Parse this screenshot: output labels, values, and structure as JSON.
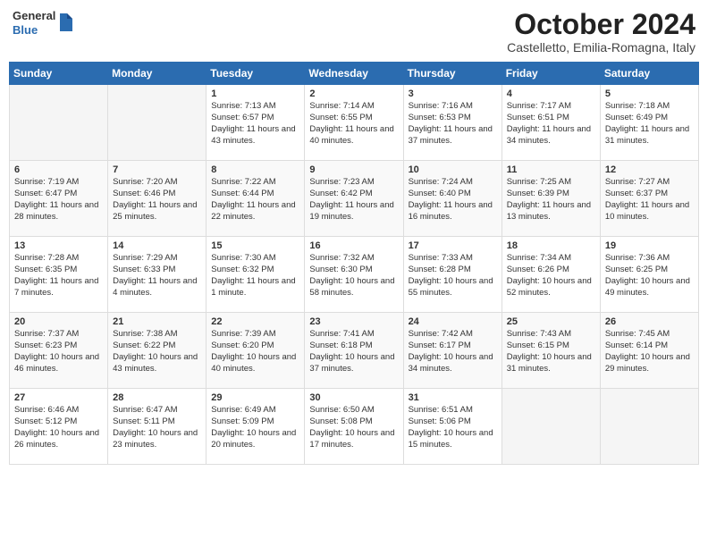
{
  "header": {
    "logo_line1": "General",
    "logo_line2": "Blue",
    "month_title": "October 2024",
    "location": "Castelletto, Emilia-Romagna, Italy"
  },
  "days_of_week": [
    "Sunday",
    "Monday",
    "Tuesday",
    "Wednesday",
    "Thursday",
    "Friday",
    "Saturday"
  ],
  "weeks": [
    [
      {
        "day": "",
        "empty": true
      },
      {
        "day": "",
        "empty": true
      },
      {
        "day": "1",
        "sunrise": "Sunrise: 7:13 AM",
        "sunset": "Sunset: 6:57 PM",
        "daylight": "Daylight: 11 hours and 43 minutes."
      },
      {
        "day": "2",
        "sunrise": "Sunrise: 7:14 AM",
        "sunset": "Sunset: 6:55 PM",
        "daylight": "Daylight: 11 hours and 40 minutes."
      },
      {
        "day": "3",
        "sunrise": "Sunrise: 7:16 AM",
        "sunset": "Sunset: 6:53 PM",
        "daylight": "Daylight: 11 hours and 37 minutes."
      },
      {
        "day": "4",
        "sunrise": "Sunrise: 7:17 AM",
        "sunset": "Sunset: 6:51 PM",
        "daylight": "Daylight: 11 hours and 34 minutes."
      },
      {
        "day": "5",
        "sunrise": "Sunrise: 7:18 AM",
        "sunset": "Sunset: 6:49 PM",
        "daylight": "Daylight: 11 hours and 31 minutes."
      }
    ],
    [
      {
        "day": "6",
        "sunrise": "Sunrise: 7:19 AM",
        "sunset": "Sunset: 6:47 PM",
        "daylight": "Daylight: 11 hours and 28 minutes."
      },
      {
        "day": "7",
        "sunrise": "Sunrise: 7:20 AM",
        "sunset": "Sunset: 6:46 PM",
        "daylight": "Daylight: 11 hours and 25 minutes."
      },
      {
        "day": "8",
        "sunrise": "Sunrise: 7:22 AM",
        "sunset": "Sunset: 6:44 PM",
        "daylight": "Daylight: 11 hours and 22 minutes."
      },
      {
        "day": "9",
        "sunrise": "Sunrise: 7:23 AM",
        "sunset": "Sunset: 6:42 PM",
        "daylight": "Daylight: 11 hours and 19 minutes."
      },
      {
        "day": "10",
        "sunrise": "Sunrise: 7:24 AM",
        "sunset": "Sunset: 6:40 PM",
        "daylight": "Daylight: 11 hours and 16 minutes."
      },
      {
        "day": "11",
        "sunrise": "Sunrise: 7:25 AM",
        "sunset": "Sunset: 6:39 PM",
        "daylight": "Daylight: 11 hours and 13 minutes."
      },
      {
        "day": "12",
        "sunrise": "Sunrise: 7:27 AM",
        "sunset": "Sunset: 6:37 PM",
        "daylight": "Daylight: 11 hours and 10 minutes."
      }
    ],
    [
      {
        "day": "13",
        "sunrise": "Sunrise: 7:28 AM",
        "sunset": "Sunset: 6:35 PM",
        "daylight": "Daylight: 11 hours and 7 minutes."
      },
      {
        "day": "14",
        "sunrise": "Sunrise: 7:29 AM",
        "sunset": "Sunset: 6:33 PM",
        "daylight": "Daylight: 11 hours and 4 minutes."
      },
      {
        "day": "15",
        "sunrise": "Sunrise: 7:30 AM",
        "sunset": "Sunset: 6:32 PM",
        "daylight": "Daylight: 11 hours and 1 minute."
      },
      {
        "day": "16",
        "sunrise": "Sunrise: 7:32 AM",
        "sunset": "Sunset: 6:30 PM",
        "daylight": "Daylight: 10 hours and 58 minutes."
      },
      {
        "day": "17",
        "sunrise": "Sunrise: 7:33 AM",
        "sunset": "Sunset: 6:28 PM",
        "daylight": "Daylight: 10 hours and 55 minutes."
      },
      {
        "day": "18",
        "sunrise": "Sunrise: 7:34 AM",
        "sunset": "Sunset: 6:26 PM",
        "daylight": "Daylight: 10 hours and 52 minutes."
      },
      {
        "day": "19",
        "sunrise": "Sunrise: 7:36 AM",
        "sunset": "Sunset: 6:25 PM",
        "daylight": "Daylight: 10 hours and 49 minutes."
      }
    ],
    [
      {
        "day": "20",
        "sunrise": "Sunrise: 7:37 AM",
        "sunset": "Sunset: 6:23 PM",
        "daylight": "Daylight: 10 hours and 46 minutes."
      },
      {
        "day": "21",
        "sunrise": "Sunrise: 7:38 AM",
        "sunset": "Sunset: 6:22 PM",
        "daylight": "Daylight: 10 hours and 43 minutes."
      },
      {
        "day": "22",
        "sunrise": "Sunrise: 7:39 AM",
        "sunset": "Sunset: 6:20 PM",
        "daylight": "Daylight: 10 hours and 40 minutes."
      },
      {
        "day": "23",
        "sunrise": "Sunrise: 7:41 AM",
        "sunset": "Sunset: 6:18 PM",
        "daylight": "Daylight: 10 hours and 37 minutes."
      },
      {
        "day": "24",
        "sunrise": "Sunrise: 7:42 AM",
        "sunset": "Sunset: 6:17 PM",
        "daylight": "Daylight: 10 hours and 34 minutes."
      },
      {
        "day": "25",
        "sunrise": "Sunrise: 7:43 AM",
        "sunset": "Sunset: 6:15 PM",
        "daylight": "Daylight: 10 hours and 31 minutes."
      },
      {
        "day": "26",
        "sunrise": "Sunrise: 7:45 AM",
        "sunset": "Sunset: 6:14 PM",
        "daylight": "Daylight: 10 hours and 29 minutes."
      }
    ],
    [
      {
        "day": "27",
        "sunrise": "Sunrise: 6:46 AM",
        "sunset": "Sunset: 5:12 PM",
        "daylight": "Daylight: 10 hours and 26 minutes."
      },
      {
        "day": "28",
        "sunrise": "Sunrise: 6:47 AM",
        "sunset": "Sunset: 5:11 PM",
        "daylight": "Daylight: 10 hours and 23 minutes."
      },
      {
        "day": "29",
        "sunrise": "Sunrise: 6:49 AM",
        "sunset": "Sunset: 5:09 PM",
        "daylight": "Daylight: 10 hours and 20 minutes."
      },
      {
        "day": "30",
        "sunrise": "Sunrise: 6:50 AM",
        "sunset": "Sunset: 5:08 PM",
        "daylight": "Daylight: 10 hours and 17 minutes."
      },
      {
        "day": "31",
        "sunrise": "Sunrise: 6:51 AM",
        "sunset": "Sunset: 5:06 PM",
        "daylight": "Daylight: 10 hours and 15 minutes."
      },
      {
        "day": "",
        "empty": true
      },
      {
        "day": "",
        "empty": true
      }
    ]
  ]
}
